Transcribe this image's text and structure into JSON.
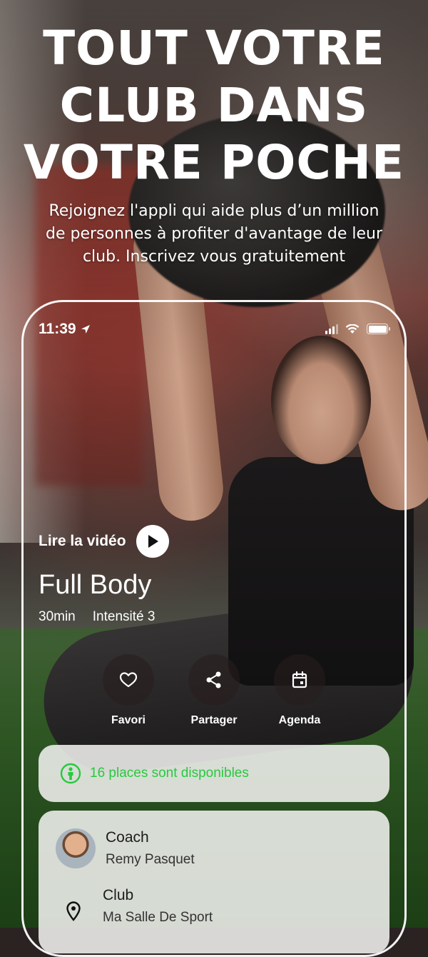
{
  "hero": {
    "headline_lines": [
      "TOUT VOTRE",
      "CLUB DANS",
      "VOTRE POCHE"
    ],
    "subtitle_lines": [
      "Rejoignez l'appli qui aide plus d’un million",
      "de personnes à profiter d'avantage de leur",
      "club. Inscrivez vous gratuitement"
    ]
  },
  "status_bar": {
    "time": "11:39",
    "icons": [
      "location-arrow-icon",
      "signal-bars-icon",
      "wifi-icon",
      "battery-icon"
    ]
  },
  "video": {
    "play_label": "Lire la vidéo",
    "play_icon": "play-icon"
  },
  "workout": {
    "title": "Full Body",
    "duration": "30min",
    "intensity": "Intensité 3"
  },
  "actions": [
    {
      "label": "Favori",
      "icon": "heart-icon"
    },
    {
      "label": "Partager",
      "icon": "share-icon"
    },
    {
      "label": "Agenda",
      "icon": "calendar-icon"
    }
  ],
  "availability": {
    "text": "16 places sont disponibles",
    "icon": "person-icon",
    "color": "#27c93f"
  },
  "details": {
    "coach_label": "Coach",
    "coach_name": "Remy Pasquet",
    "club_label": "Club",
    "club_name": "Ma Salle De Sport",
    "club_icon": "location-pin-icon"
  }
}
